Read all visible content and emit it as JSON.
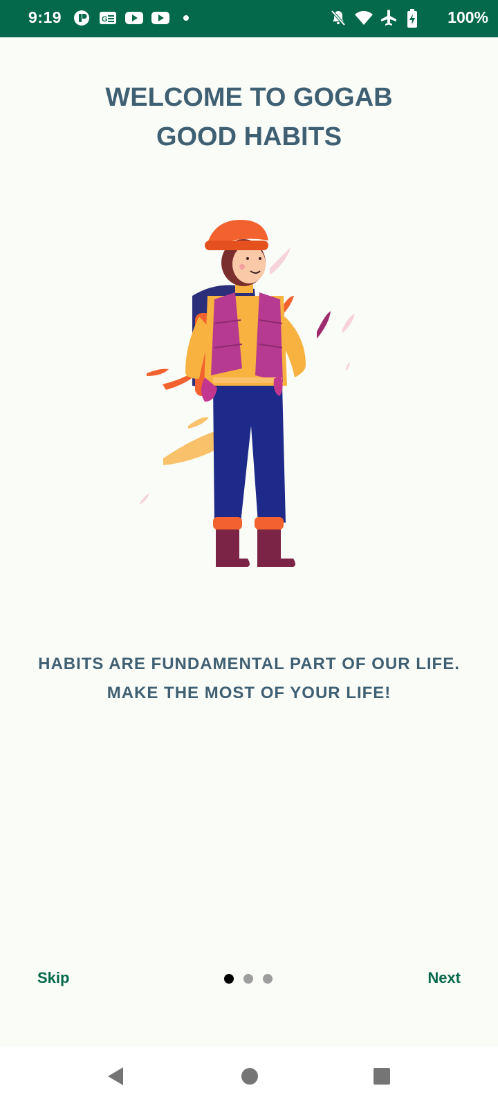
{
  "status_bar": {
    "time": "9:19",
    "battery_text": "100%",
    "left_icons": [
      "notification-app-icon",
      "news-icon",
      "youtube-icon",
      "youtube-icon",
      "dot-icon"
    ],
    "right_icons": [
      "notifications-off-icon",
      "wifi-icon",
      "airplane-mode-icon",
      "battery-charging-icon"
    ],
    "background_color": "#03694A"
  },
  "onboarding": {
    "title_line1": "WELCOME TO GOGAB",
    "title_line2": "GOOD HABITS",
    "subtitle_line1": "HABITS ARE FUNDAMENTAL PART OF OUR LIFE.",
    "subtitle_line2": "MAKE THE MOST OF YOUR LIFE!",
    "illustration": "hiker-girl-illustration",
    "text_color": "#3F5F72"
  },
  "controls": {
    "skip_label": "Skip",
    "next_label": "Next",
    "page_count": 3,
    "current_page": 1,
    "accent_color": "#03694A"
  },
  "nav_bar": {
    "buttons": [
      "back-icon",
      "home-icon",
      "recents-icon"
    ]
  }
}
